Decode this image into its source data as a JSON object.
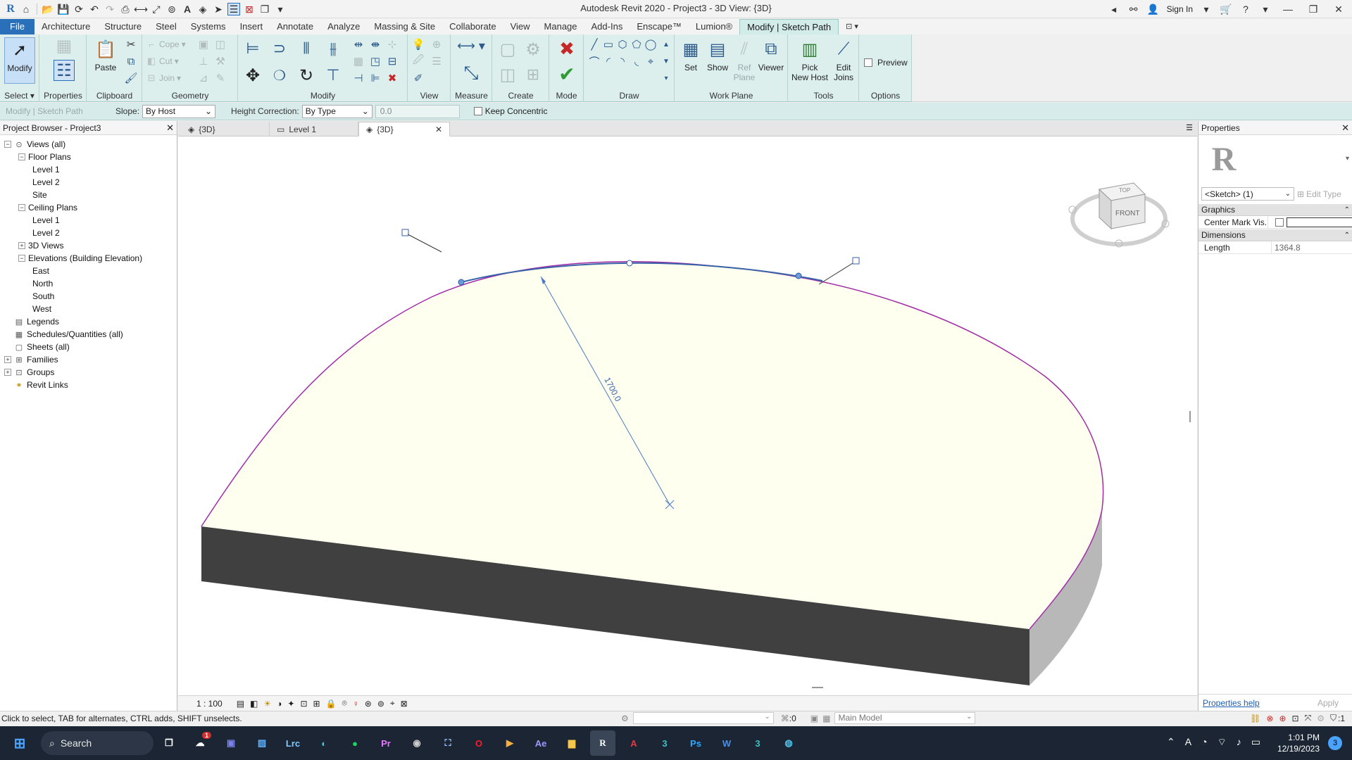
{
  "window": {
    "title": "Autodesk Revit 2020 - Project3 - 3D View: {3D}",
    "sign_in": "Sign In"
  },
  "ribbon_tabs": [
    "File",
    "Architecture",
    "Structure",
    "Steel",
    "Systems",
    "Insert",
    "Annotate",
    "Analyze",
    "Massing & Site",
    "Collaborate",
    "View",
    "Manage",
    "Add-Ins",
    "Enscape™",
    "Lumion®",
    "Modify | Sketch Path"
  ],
  "ribbon": {
    "select": {
      "modify": "Modify",
      "title": "Select"
    },
    "properties": {
      "label": "Properties"
    },
    "clipboard": {
      "paste": "Paste",
      "title": "Clipboard"
    },
    "geometry": {
      "cope": "Cope",
      "cut": "Cut",
      "join": "Join",
      "title": "Geometry"
    },
    "modify": {
      "title": "Modify"
    },
    "view": {
      "title": "View"
    },
    "measure": {
      "title": "Measure"
    },
    "create": {
      "title": "Create"
    },
    "mode": {
      "title": "Mode"
    },
    "draw": {
      "title": "Draw"
    },
    "work_plane": {
      "set": "Set",
      "show": "Show",
      "ref_plane_1": "Ref",
      "ref_plane_2": "Plane",
      "viewer": "Viewer",
      "title": "Work Plane"
    },
    "tools": {
      "pick_1": "Pick",
      "pick_2": "New Host",
      "edit_1": "Edit",
      "edit_2": "Joins",
      "title": "Tools"
    },
    "options": {
      "preview": "Preview",
      "title": "Options"
    }
  },
  "options_bar": {
    "context": "Modify | Sketch Path",
    "slope_label": "Slope:",
    "slope_value": "By Host",
    "height_label": "Height Correction:",
    "height_value": "By Type",
    "height_amount": "0.0",
    "keep_concentric": "Keep Concentric"
  },
  "project_browser": {
    "title": "Project Browser - Project3",
    "items": [
      {
        "label": "Views (all)",
        "level": 0,
        "toggle": "-"
      },
      {
        "label": "Floor Plans",
        "level": 1,
        "toggle": "-"
      },
      {
        "label": "Level 1",
        "level": 2,
        "toggle": ""
      },
      {
        "label": "Level 2",
        "level": 2,
        "toggle": ""
      },
      {
        "label": "Site",
        "level": 2,
        "toggle": ""
      },
      {
        "label": "Ceiling Plans",
        "level": 1,
        "toggle": "-"
      },
      {
        "label": "Level 1",
        "level": 2,
        "toggle": ""
      },
      {
        "label": "Level 2",
        "level": 2,
        "toggle": ""
      },
      {
        "label": "3D Views",
        "level": 1,
        "toggle": "+"
      },
      {
        "label": "Elevations (Building Elevation)",
        "level": 1,
        "toggle": "-"
      },
      {
        "label": "East",
        "level": 2,
        "toggle": ""
      },
      {
        "label": "North",
        "level": 2,
        "toggle": ""
      },
      {
        "label": "South",
        "level": 2,
        "toggle": ""
      },
      {
        "label": "West",
        "level": 2,
        "toggle": ""
      },
      {
        "label": "Legends",
        "level": 0,
        "toggle": ""
      },
      {
        "label": "Schedules/Quantities (all)",
        "level": 0,
        "toggle": ""
      },
      {
        "label": "Sheets (all)",
        "level": 0,
        "toggle": ""
      },
      {
        "label": "Families",
        "level": 0,
        "toggle": "+"
      },
      {
        "label": "Groups",
        "level": 0,
        "toggle": "+"
      },
      {
        "label": "Revit Links",
        "level": 0,
        "toggle": ""
      }
    ]
  },
  "view_tabs": [
    {
      "label": "{3D}",
      "active": false
    },
    {
      "label": "Level 1",
      "active": false
    },
    {
      "label": "{3D}",
      "active": true
    }
  ],
  "canvas": {
    "dimension": "1700.0",
    "viewcube_top": "TOP",
    "viewcube_front": "FRONT"
  },
  "view_bar": {
    "scale": "1 : 100"
  },
  "properties": {
    "title": "Properties",
    "type_selector": "<Sketch> (1)",
    "edit_type": "Edit Type",
    "sections": {
      "graphics": "Graphics",
      "dimensions": "Dimensions"
    },
    "center_mark_label": "Center Mark Vis...",
    "length_label": "Length",
    "length_value": "1364.8",
    "help": "Properties help",
    "apply": "Apply"
  },
  "status": {
    "hint": "Click to select, TAB for alternates, CTRL adds, SHIFT unselects.",
    "count": ":0",
    "model": "Main Model",
    "filter_count": ":1"
  },
  "taskbar": {
    "search": "Search",
    "time": "1:01 PM",
    "date": "12/19/2023",
    "notification_count": "3",
    "badge": "1"
  },
  "colors": {
    "accent": "#2a6fba",
    "ribbon": "#dcefed",
    "floor_top": "#fffff0",
    "floor_side": "#404040",
    "sketch_line": "#a02ca8",
    "selected_line": "#3a62a8"
  }
}
